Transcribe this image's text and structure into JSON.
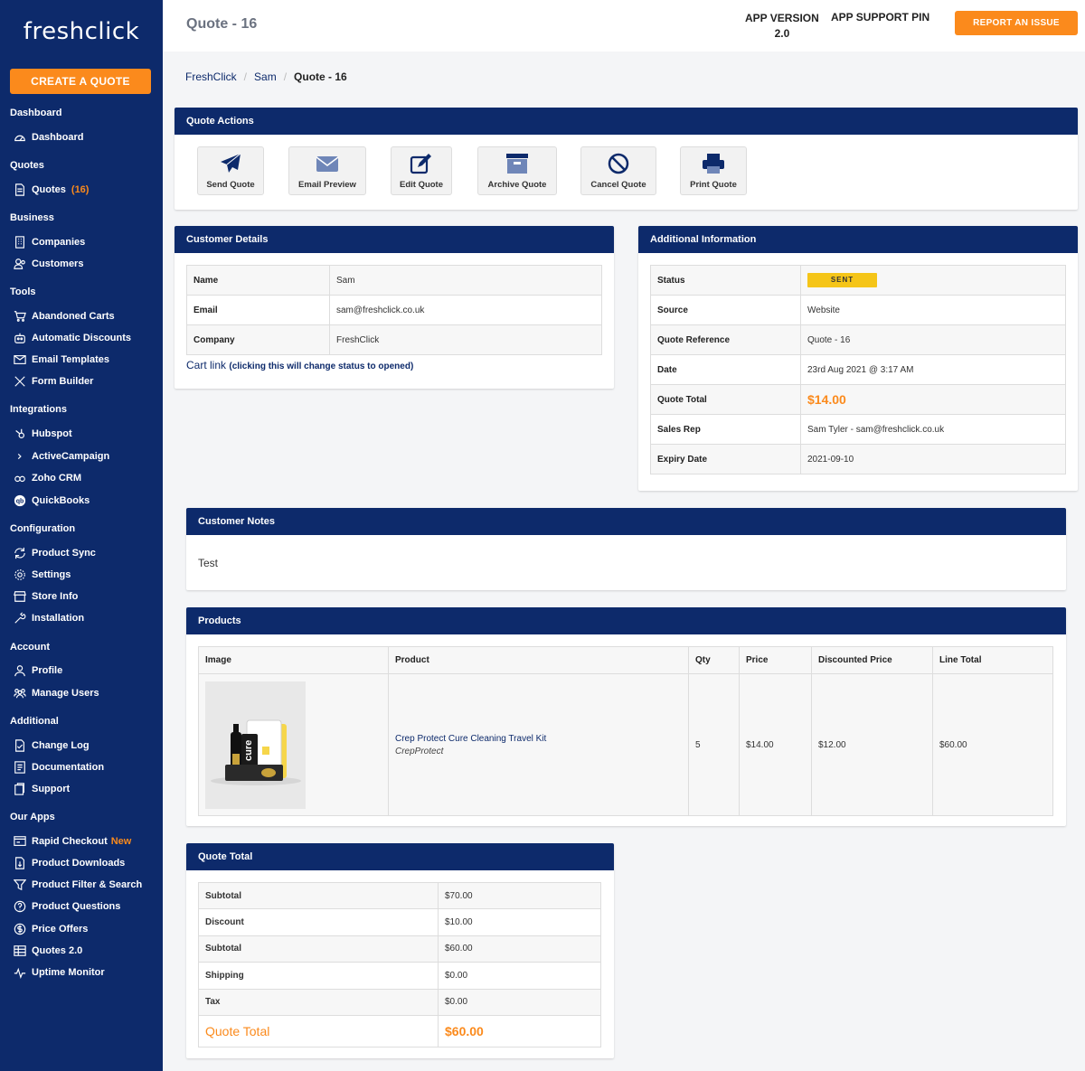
{
  "app": {
    "logo_text": "freshclick"
  },
  "sidebar": {
    "create_quote": "CREATE A QUOTE",
    "sections": [
      {
        "title": "Dashboard",
        "items": [
          {
            "label": "Dashboard",
            "icon": "gauge-icon"
          }
        ]
      },
      {
        "title": "Quotes",
        "items": [
          {
            "label": "Quotes",
            "count": "(16)",
            "icon": "document-icon"
          }
        ]
      },
      {
        "title": "Business",
        "items": [
          {
            "label": "Companies",
            "icon": "building-icon"
          },
          {
            "label": "Customers",
            "icon": "users-icon"
          }
        ]
      },
      {
        "title": "Tools",
        "items": [
          {
            "label": "Abandoned Carts",
            "icon": "cart-icon"
          },
          {
            "label": "Automatic Discounts",
            "icon": "robot-icon"
          },
          {
            "label": "Email Templates",
            "icon": "email-icon"
          },
          {
            "label": "Form Builder",
            "icon": "tools-icon"
          }
        ]
      },
      {
        "title": "Integrations",
        "items": [
          {
            "label": "Hubspot",
            "icon": "hubspot-icon"
          },
          {
            "label": "ActiveCampaign",
            "icon": "chevron-right-icon"
          },
          {
            "label": "Zoho CRM",
            "icon": "zoho-icon"
          },
          {
            "label": "QuickBooks",
            "icon": "quickbooks-icon"
          }
        ]
      },
      {
        "title": "Configuration",
        "items": [
          {
            "label": "Product Sync",
            "icon": "sync-icon"
          },
          {
            "label": "Settings",
            "icon": "gear-icon"
          },
          {
            "label": "Store Info",
            "icon": "store-icon"
          },
          {
            "label": "Installation",
            "icon": "wrench-icon"
          }
        ]
      },
      {
        "title": "Account",
        "items": [
          {
            "label": "Profile",
            "icon": "user-icon"
          },
          {
            "label": "Manage Users",
            "icon": "group-icon"
          }
        ]
      },
      {
        "title": "Additional",
        "items": [
          {
            "label": "Change Log",
            "icon": "changelog-icon"
          },
          {
            "label": "Documentation",
            "icon": "book-icon"
          },
          {
            "label": "Support",
            "icon": "support-icon"
          }
        ]
      },
      {
        "title": "Our Apps",
        "items": [
          {
            "label": "Rapid Checkout",
            "badge": "New",
            "icon": "checkout-icon"
          },
          {
            "label": "Product Downloads",
            "icon": "download-doc-icon"
          },
          {
            "label": "Product Filter & Search",
            "icon": "filter-icon"
          },
          {
            "label": "Product Questions",
            "icon": "question-icon"
          },
          {
            "label": "Price Offers",
            "icon": "dollar-icon"
          },
          {
            "label": "Quotes 2.0",
            "icon": "table-icon"
          },
          {
            "label": "Uptime Monitor",
            "icon": "pulse-icon"
          }
        ]
      }
    ]
  },
  "header": {
    "title": "Quote - 16",
    "app_version_label": "APP VERSION",
    "app_version_value": "2.0",
    "support_pin_label": "APP SUPPORT PIN",
    "report_button": "REPORT AN ISSUE"
  },
  "breadcrumb": {
    "items": [
      "FreshClick",
      "Sam"
    ],
    "current": "Quote - 16"
  },
  "quote_actions": {
    "title": "Quote Actions",
    "buttons": [
      {
        "label": "Send Quote",
        "icon": "send-icon"
      },
      {
        "label": "Email Preview",
        "icon": "envelope-icon"
      },
      {
        "label": "Edit Quote",
        "icon": "edit-icon"
      },
      {
        "label": "Archive Quote",
        "icon": "archive-icon"
      },
      {
        "label": "Cancel Quote",
        "icon": "ban-icon"
      },
      {
        "label": "Print Quote",
        "icon": "printer-icon"
      }
    ]
  },
  "customer_details": {
    "title": "Customer Details",
    "rows": [
      {
        "key": "Name",
        "value": "Sam"
      },
      {
        "key": "Email",
        "value": "sam@freshclick.co.uk"
      },
      {
        "key": "Company",
        "value": "FreshClick"
      }
    ],
    "cart_link": "Cart link",
    "cart_link_note": "(clicking this will change status to opened)"
  },
  "additional_info": {
    "title": "Additional Information",
    "status_label": "Status",
    "status_value": "SENT",
    "rows": [
      {
        "key": "Source",
        "value": "Website"
      },
      {
        "key": "Quote Reference",
        "value": "Quote - 16"
      },
      {
        "key": "Date",
        "value": "23rd Aug 2021 @ 3:17 AM"
      }
    ],
    "total_label": "Quote Total",
    "total_value": "$14.00",
    "rows2": [
      {
        "key": "Sales Rep",
        "value": "Sam Tyler - sam@freshclick.co.uk"
      },
      {
        "key": "Expiry Date",
        "value": "2021-09-10"
      }
    ]
  },
  "customer_notes": {
    "title": "Customer Notes",
    "text": "Test"
  },
  "products": {
    "title": "Products",
    "columns": [
      "Image",
      "Product",
      "Qty",
      "Price",
      "Discounted Price",
      "Line Total"
    ],
    "rows": [
      {
        "name": "Crep Protect Cure Cleaning Travel Kit",
        "vendor": "CrepProtect",
        "qty": "5",
        "price": "$14.00",
        "discounted": "$12.00",
        "line_total": "$60.00",
        "image_text": "cure"
      }
    ]
  },
  "quote_total": {
    "title": "Quote Total",
    "rows": [
      {
        "key": "Subtotal",
        "value": "$70.00"
      },
      {
        "key": "Discount",
        "value": "$10.00"
      },
      {
        "key": "Subtotal",
        "value": "$60.00"
      },
      {
        "key": "Shipping",
        "value": "$0.00"
      },
      {
        "key": "Tax",
        "value": "$0.00"
      }
    ],
    "final_label": "Quote Total",
    "final_value": "$60.00"
  },
  "colors": {
    "navy": "#0d2a6b",
    "orange": "#fb8a1c",
    "badge": "#f5c518"
  }
}
